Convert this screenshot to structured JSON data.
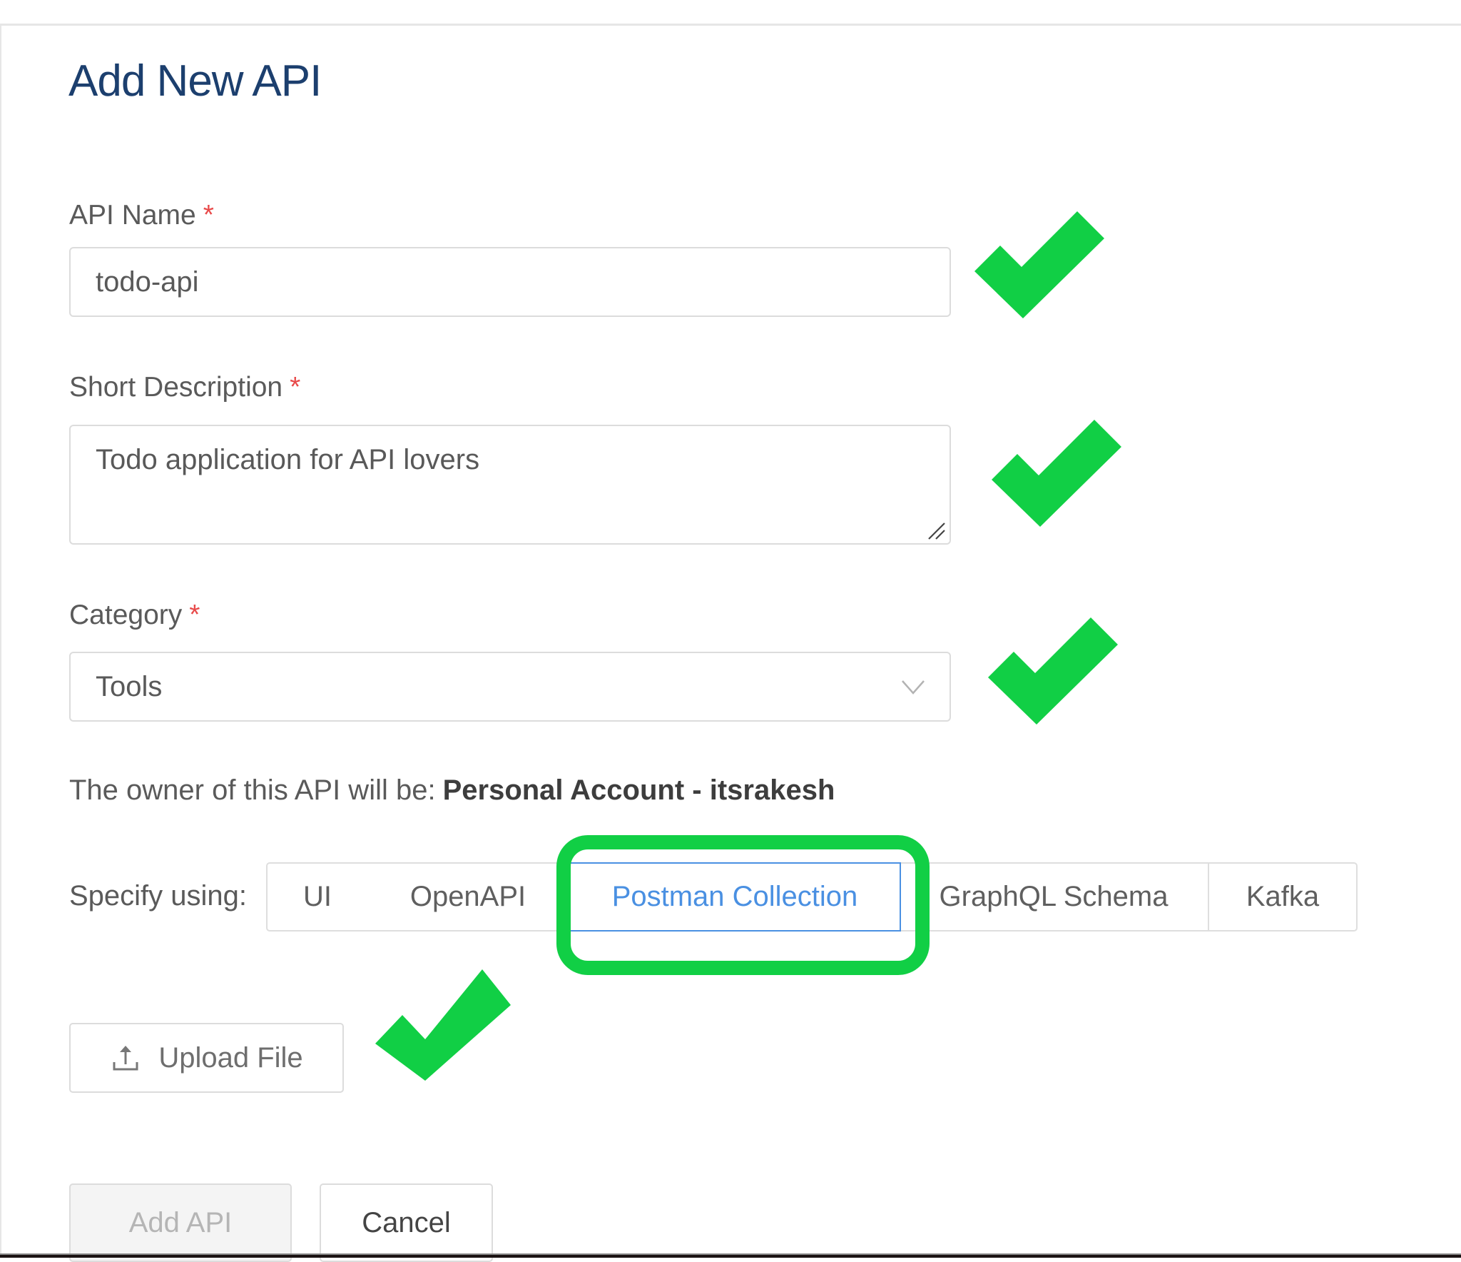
{
  "page": {
    "title": "Add New API"
  },
  "form": {
    "api_name": {
      "label": "API Name",
      "required_marker": "*",
      "value": "todo-api"
    },
    "short_description": {
      "label": "Short Description",
      "required_marker": "*",
      "value": "Todo application for API lovers"
    },
    "category": {
      "label": "Category",
      "required_marker": "*",
      "selected": "Tools"
    },
    "owner": {
      "prefix": "The owner of this API will be:",
      "value": "Personal Account - itsrakesh"
    },
    "specify_using": {
      "label": "Specify using:",
      "options": [
        "UI",
        "OpenAPI",
        "Postman Collection",
        "GraphQL Schema",
        "Kafka"
      ],
      "selected": "Postman Collection"
    },
    "upload": {
      "label": "Upload File",
      "icon": "upload-icon"
    }
  },
  "actions": {
    "add_api_label": "Add API",
    "add_api_disabled": true,
    "cancel_label": "Cancel"
  },
  "annotations": {
    "check_icon": "checkmark-icon",
    "highlight_color": "#11cf45"
  },
  "colors": {
    "title": "#1c3f6e",
    "required": "#e84a4a",
    "selected_option": "#4a90e2",
    "annotation_green": "#11cf45"
  }
}
